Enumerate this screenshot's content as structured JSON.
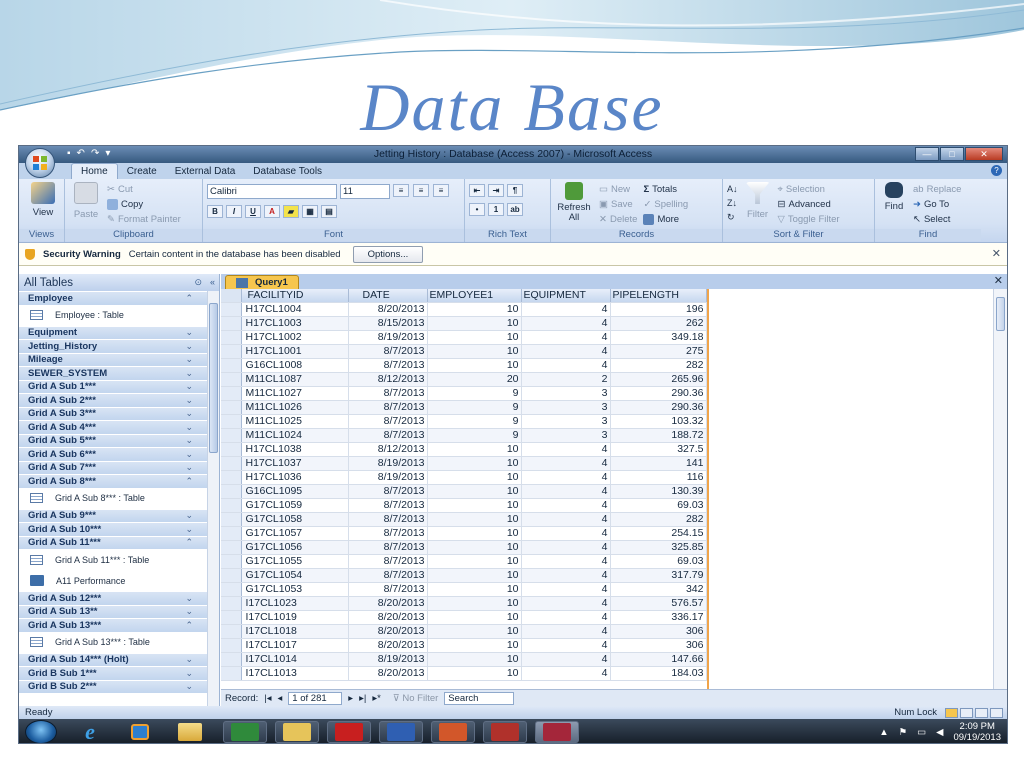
{
  "slide_title": "Data Base",
  "window": {
    "title": "Jetting History : Database (Access 2007) - Microsoft Access",
    "controls": [
      "—",
      "□",
      "✕"
    ]
  },
  "ribbon_tabs": [
    "Home",
    "Create",
    "External Data",
    "Database Tools"
  ],
  "ribbon": {
    "views": {
      "view": "View",
      "label": "Views"
    },
    "clipboard": {
      "paste": "Paste",
      "cut": "Cut",
      "copy": "Copy",
      "format_painter": "Format Painter",
      "label": "Clipboard"
    },
    "font": {
      "name": "Calibri",
      "size": "11",
      "bold": "B",
      "italic": "I",
      "underline": "U",
      "label": "Font"
    },
    "rich_text": {
      "label": "Rich Text"
    },
    "records": {
      "refresh": "Refresh All",
      "new": "New",
      "save": "Save",
      "delete": "Delete",
      "totals": "Totals",
      "spelling": "Spelling",
      "more": "More",
      "label": "Records"
    },
    "sort_filter": {
      "filter": "Filter",
      "selection": "Selection",
      "advanced": "Advanced",
      "toggle_filter": "Toggle Filter",
      "label": "Sort & Filter"
    },
    "find": {
      "find": "Find",
      "replace": "Replace",
      "goto": "Go To",
      "select": "Select",
      "label": "Find"
    }
  },
  "security": {
    "title": "Security Warning",
    "message": "Certain content in the database has been disabled",
    "options": "Options..."
  },
  "nav": {
    "header": "All Tables",
    "sections": [
      {
        "label": "Employee",
        "expanded": true,
        "items": [
          {
            "label": "Employee : Table",
            "type": "table"
          }
        ]
      },
      {
        "label": "Equipment"
      },
      {
        "label": "Jetting_History"
      },
      {
        "label": "Mileage"
      },
      {
        "label": "SEWER_SYSTEM"
      },
      {
        "label": "Grid A Sub 1***"
      },
      {
        "label": "Grid A Sub 2***"
      },
      {
        "label": "Grid A Sub 3***"
      },
      {
        "label": "Grid A Sub 4***"
      },
      {
        "label": "Grid A Sub 5***"
      },
      {
        "label": "Grid A Sub 6***"
      },
      {
        "label": "Grid A Sub 7***"
      },
      {
        "label": "Grid A Sub 8***",
        "expanded": true,
        "items": [
          {
            "label": "Grid A Sub 8*** : Table",
            "type": "table"
          }
        ]
      },
      {
        "label": "Grid A Sub 9***"
      },
      {
        "label": "Grid A Sub 10***"
      },
      {
        "label": "Grid A Sub 11***",
        "expanded": true,
        "items": [
          {
            "label": "Grid A Sub 11*** : Table",
            "type": "table"
          },
          {
            "label": "A11 Performance",
            "type": "form"
          }
        ]
      },
      {
        "label": "Grid A Sub 12***"
      },
      {
        "label": "Grid A Sub 13**"
      },
      {
        "label": "Grid A Sub 13***",
        "expanded": true,
        "items": [
          {
            "label": "Grid A Sub 13*** : Table",
            "type": "table"
          }
        ]
      },
      {
        "label": "Grid A Sub 14*** (Holt)"
      },
      {
        "label": "Grid B Sub 1***"
      },
      {
        "label": "Grid B Sub 2***"
      }
    ]
  },
  "query_tab": "Query1",
  "grid": {
    "columns": [
      "FACILITYID",
      "DATE",
      "EMPLOYEE1",
      "EQUIPMENT",
      "PIPELENGTH"
    ],
    "rows": [
      [
        "H17CL1004",
        "8/20/2013",
        "10",
        "4",
        "196"
      ],
      [
        "H17CL1003",
        "8/15/2013",
        "10",
        "4",
        "262"
      ],
      [
        "H17CL1002",
        "8/19/2013",
        "10",
        "4",
        "349.18"
      ],
      [
        "H17CL1001",
        "8/7/2013",
        "10",
        "4",
        "275"
      ],
      [
        "G16CL1008",
        "8/7/2013",
        "10",
        "4",
        "282"
      ],
      [
        "M11CL1087",
        "8/12/2013",
        "20",
        "2",
        "265.96"
      ],
      [
        "M11CL1027",
        "8/7/2013",
        "9",
        "3",
        "290.36"
      ],
      [
        "M11CL1026",
        "8/7/2013",
        "9",
        "3",
        "290.36"
      ],
      [
        "M11CL1025",
        "8/7/2013",
        "9",
        "3",
        "103.32"
      ],
      [
        "M11CL1024",
        "8/7/2013",
        "9",
        "3",
        "188.72"
      ],
      [
        "H17CL1038",
        "8/12/2013",
        "10",
        "4",
        "327.5"
      ],
      [
        "H17CL1037",
        "8/19/2013",
        "10",
        "4",
        "141"
      ],
      [
        "H17CL1036",
        "8/19/2013",
        "10",
        "4",
        "116"
      ],
      [
        "G16CL1095",
        "8/7/2013",
        "10",
        "4",
        "130.39"
      ],
      [
        "G17CL1059",
        "8/7/2013",
        "10",
        "4",
        "69.03"
      ],
      [
        "G17CL1058",
        "8/7/2013",
        "10",
        "4",
        "282"
      ],
      [
        "G17CL1057",
        "8/7/2013",
        "10",
        "4",
        "254.15"
      ],
      [
        "G17CL1056",
        "8/7/2013",
        "10",
        "4",
        "325.85"
      ],
      [
        "G17CL1055",
        "8/7/2013",
        "10",
        "4",
        "69.03"
      ],
      [
        "G17CL1054",
        "8/7/2013",
        "10",
        "4",
        "317.79"
      ],
      [
        "G17CL1053",
        "8/7/2013",
        "10",
        "4",
        "342"
      ],
      [
        "I17CL1023",
        "8/20/2013",
        "10",
        "4",
        "576.57"
      ],
      [
        "I17CL1019",
        "8/20/2013",
        "10",
        "4",
        "336.17"
      ],
      [
        "I17CL1018",
        "8/20/2013",
        "10",
        "4",
        "306"
      ],
      [
        "I17CL1017",
        "8/20/2013",
        "10",
        "4",
        "306"
      ],
      [
        "I17CL1014",
        "8/19/2013",
        "10",
        "4",
        "147.66"
      ],
      [
        "I17CL1013",
        "8/20/2013",
        "10",
        "4",
        "184.03"
      ]
    ]
  },
  "recnav": {
    "label": "Record:",
    "position": "1 of 281",
    "filter": "No Filter",
    "search": "Search"
  },
  "status": {
    "left": "Ready",
    "right": "Num Lock"
  },
  "taskbar": {
    "time": "2:09 PM",
    "date": "09/19/2013"
  },
  "colors": {
    "slide_title": "#5a86c8",
    "query_tab": "#f6c64e",
    "titlebar": "#4a6f99"
  }
}
